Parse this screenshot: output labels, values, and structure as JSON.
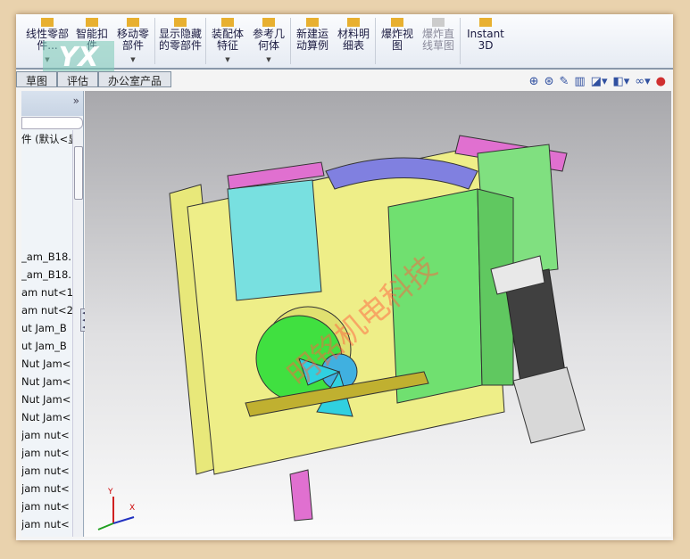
{
  "toolbar": {
    "items": [
      {
        "label": "线性零部件...",
        "dropdown": true,
        "icon": "linear-pattern-icon"
      },
      {
        "label": "智能扣件",
        "icon": "smart-fastener-icon"
      },
      {
        "label": "移动零部件",
        "dropdown": true,
        "icon": "move-component-icon"
      },
      {
        "label": "显示隐藏的零部件",
        "icon": "show-hidden-icon"
      },
      {
        "label": "装配体特征",
        "dropdown": true,
        "icon": "assembly-feature-icon"
      },
      {
        "label": "参考几何体",
        "dropdown": true,
        "icon": "reference-geometry-icon"
      },
      {
        "label": "新建运动算例",
        "icon": "motion-study-icon"
      },
      {
        "label": "材料明细表",
        "icon": "bom-icon"
      },
      {
        "label": "爆炸视图",
        "icon": "exploded-view-icon"
      },
      {
        "label": "爆炸直线草图",
        "disabled": true,
        "icon": "explode-line-icon"
      },
      {
        "label": "Instant3D",
        "icon": "instant3d-icon"
      }
    ]
  },
  "tabs": [
    "草图",
    "评估",
    "办公室产品"
  ],
  "panel": {
    "expand": "»",
    "root": "件 (默认<显",
    "items": [
      "_am_B18.",
      "_am_B18.",
      "am nut<1",
      "am nut<2",
      "ut Jam_B",
      "ut Jam_B",
      "Nut Jam<",
      "Nut Jam<",
      "Nut Jam<",
      "Nut Jam<",
      "jam nut<",
      "jam nut<",
      "jam nut<",
      "jam nut<",
      "jam nut<",
      "jam nut<"
    ]
  },
  "viewport": {
    "watermark": "明铭机电科技",
    "axes": {
      "x": "X",
      "y": "Y"
    }
  },
  "colors": {
    "plate": "#e8e87a",
    "green": "#70e070",
    "cyan": "#70e0e0",
    "magenta": "#e070d0",
    "motor": "#404040"
  }
}
